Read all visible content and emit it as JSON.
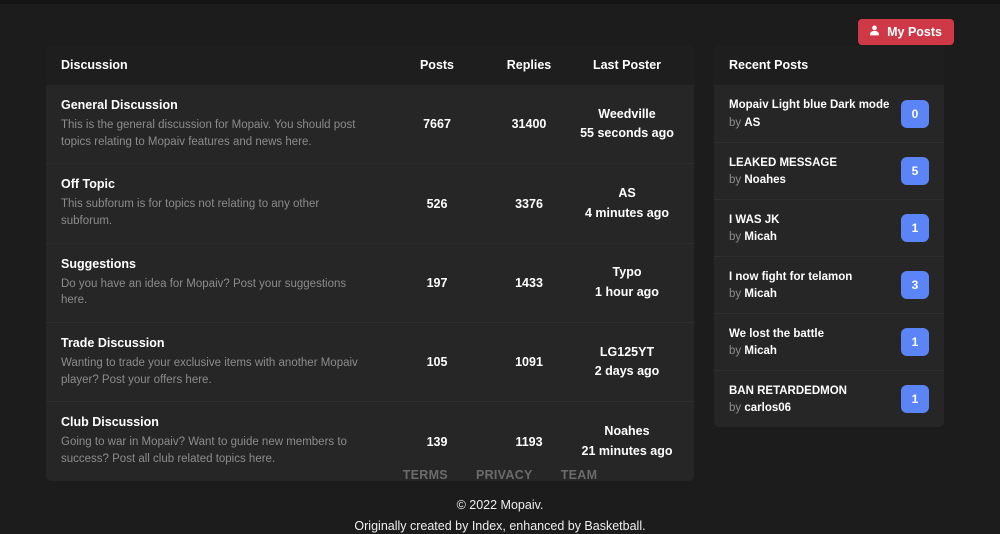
{
  "theme": {
    "page_bg": "#1c1c1c",
    "panel_bg": "#262626",
    "panel_head_bg": "#1e1e1e",
    "accent_red": "#cf3846",
    "accent_blue": "#5b85f7",
    "muted_text": "#8c8c8c"
  },
  "header": {
    "my_posts_label": "My Posts",
    "my_posts_icon": "person-icon"
  },
  "forum": {
    "columns": {
      "discussion": "Discussion",
      "posts": "Posts",
      "replies": "Replies",
      "last_poster": "Last Poster"
    },
    "rows": [
      {
        "title": "General Discussion",
        "description": "This is the general discussion for Mopaiv. You should post topics relating to Mopaiv features and news here.",
        "posts": "7667",
        "replies": "31400",
        "last_poster_name": "Weedville",
        "last_poster_time": "55 seconds ago"
      },
      {
        "title": "Off Topic",
        "description": "This subforum is for topics not relating to any other subforum.",
        "posts": "526",
        "replies": "3376",
        "last_poster_name": "AS",
        "last_poster_time": "4 minutes ago"
      },
      {
        "title": "Suggestions",
        "description": "Do you have an idea for Mopaiv? Post your suggestions here.",
        "posts": "197",
        "replies": "1433",
        "last_poster_name": "Typo",
        "last_poster_time": "1 hour ago"
      },
      {
        "title": "Trade Discussion",
        "description": "Wanting to trade your exclusive items with another Mopaiv player? Post your offers here.",
        "posts": "105",
        "replies": "1091",
        "last_poster_name": "LG125YT",
        "last_poster_time": "2 days ago"
      },
      {
        "title": "Club Discussion",
        "description": "Going to war in Mopaiv? Want to guide new members to success? Post all club related topics here.",
        "posts": "139",
        "replies": "1193",
        "last_poster_name": "Noahes",
        "last_poster_time": "21 minutes ago"
      }
    ]
  },
  "recent": {
    "heading": "Recent Posts",
    "by_label": "by",
    "items": [
      {
        "title": "Mopaiv Light blue Dark mode",
        "author": "AS",
        "count": "0"
      },
      {
        "title": "LEAKED MESSAGE",
        "author": "Noahes",
        "count": "5"
      },
      {
        "title": "I WAS JK",
        "author": "Micah",
        "count": "1"
      },
      {
        "title": "I now fight for telamon",
        "author": "Micah",
        "count": "3"
      },
      {
        "title": "We lost the battle",
        "author": "Micah",
        "count": "1"
      },
      {
        "title": "BAN RETARDEDMON",
        "author": "carlos06",
        "count": "1"
      }
    ]
  },
  "footer": {
    "links": [
      "TERMS",
      "PRIVACY",
      "TEAM"
    ],
    "copyright": "© 2022 Mopaiv.",
    "credit": "Originally created by Index, enhanced by Basketball."
  }
}
